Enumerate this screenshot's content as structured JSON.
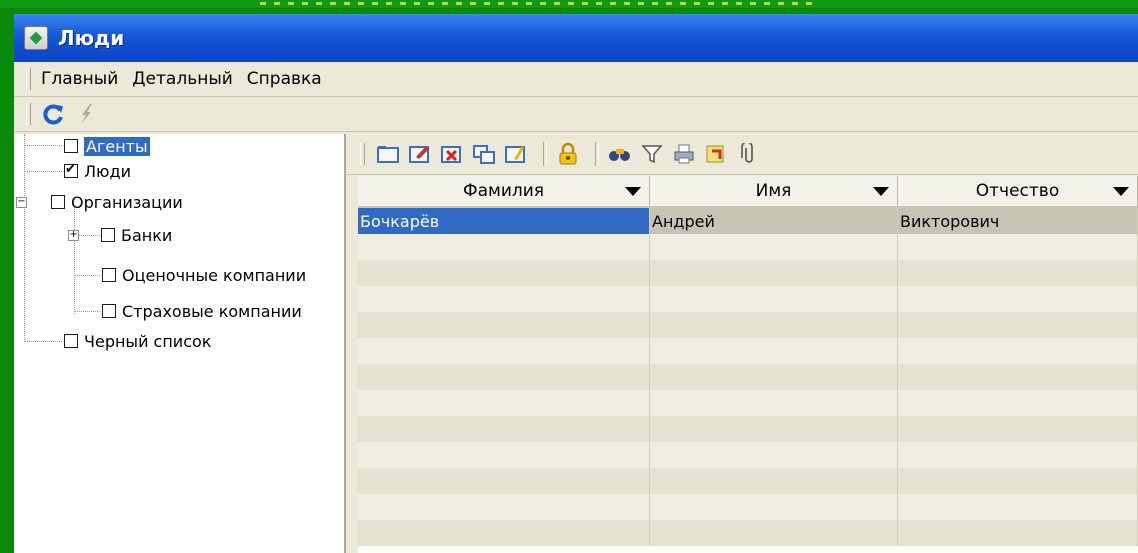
{
  "window": {
    "title": "Люди"
  },
  "menu": [
    "Главный",
    "Детальный",
    "Справка"
  ],
  "tree": {
    "items": [
      {
        "label": "Агенты",
        "checked": false,
        "selected": true
      },
      {
        "label": "Люди",
        "checked": true,
        "selected": false
      },
      {
        "label": "Организации",
        "checked": false,
        "selected": false
      },
      {
        "label": "Банки",
        "checked": false,
        "selected": false
      },
      {
        "label": "Оценочные компании",
        "checked": false,
        "selected": false
      },
      {
        "label": "Страховые компании",
        "checked": false,
        "selected": false
      },
      {
        "label": "Черный список",
        "checked": false,
        "selected": false
      }
    ]
  },
  "grid": {
    "columns": [
      "Фамилия",
      "Имя",
      "Отчество"
    ],
    "rows": [
      [
        "Бочкарёв",
        "Андрей",
        "Викторович"
      ]
    ]
  },
  "colors": {
    "selection": "#316ac5",
    "titlebar": "#1558d8",
    "background": "#0a8a0a"
  }
}
